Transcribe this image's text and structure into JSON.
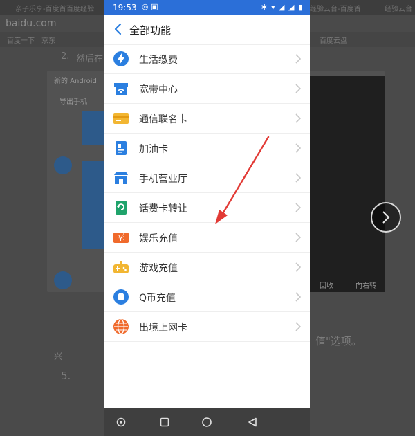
{
  "background": {
    "tabs": [
      "亲子乐享-百度首",
      "百度经验",
      "经验云台-百度首",
      "经验云台"
    ],
    "url": "baidu.com",
    "bookmarks": [
      "百度一下",
      "京东",
      "百度云盘"
    ],
    "step_num": "2.",
    "step_text": "然后在",
    "panel_title": "新的 Android",
    "panel_subtitle": "导出手机",
    "quote_text": "值\"选项。",
    "next_step": "5.",
    "bottom_mark": "兴",
    "mini_text_1": "回收",
    "mini_text_2": "向右转"
  },
  "status_bar": {
    "time": "19:53",
    "left_icons": "◎ ▣",
    "right_icons": "✱ ▾ ◢ ◢ ▮"
  },
  "app_bar": {
    "title": "全部功能"
  },
  "items": [
    {
      "label": "生活缴费",
      "icon": "lightning-icon",
      "color": "#2b7fe0"
    },
    {
      "label": "宽带中心",
      "icon": "store-wifi-icon",
      "color": "#2b7fe0"
    },
    {
      "label": "通信联名卡",
      "icon": "card-icon",
      "color": "#f2b632"
    },
    {
      "label": "加油卡",
      "icon": "fuel-card-icon",
      "color": "#2b7fe0"
    },
    {
      "label": "手机营业厅",
      "icon": "shop-icon",
      "color": "#2b7fe0"
    },
    {
      "label": "话费卡转让",
      "icon": "transfer-card-icon",
      "color": "#1fa36b"
    },
    {
      "label": "娱乐充值",
      "icon": "yen-ticket-icon",
      "color": "#f06a2c"
    },
    {
      "label": "游戏充值",
      "icon": "gamepad-icon",
      "color": "#f2b632"
    },
    {
      "label": "Q币充值",
      "icon": "qq-penguin-icon",
      "color": "#2b7fe0"
    },
    {
      "label": "出境上网卡",
      "icon": "globe-icon",
      "color": "#f06a2c"
    }
  ],
  "nav": [
    "circle-dot-icon",
    "square-icon",
    "home-circle-icon",
    "back-triangle-icon"
  ]
}
